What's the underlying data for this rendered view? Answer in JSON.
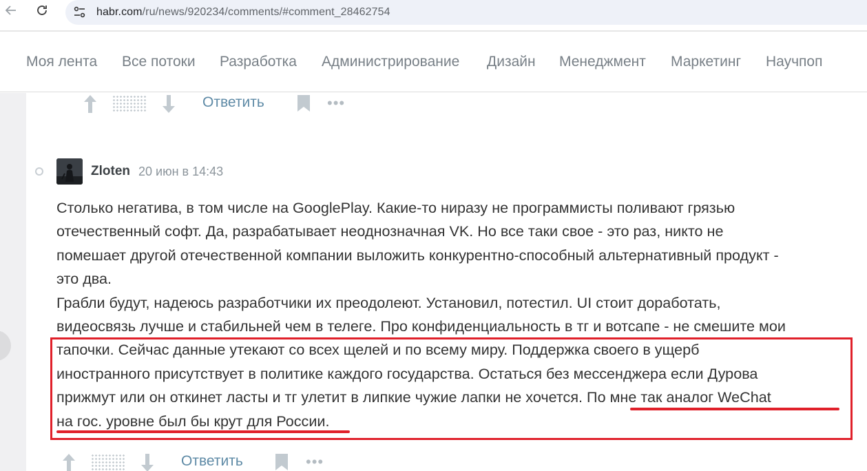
{
  "browser": {
    "url_host": "habr.com",
    "url_path": "/ru/news/920234/comments/#comment_28462754"
  },
  "menu": {
    "items": [
      "Моя лента",
      "Все потоки",
      "Разработка",
      "Администрирование",
      "Дизайн",
      "Менеджмент",
      "Маркетинг",
      "Научпоп"
    ]
  },
  "actions": {
    "reply_label": "Ответить",
    "more_label": "•••"
  },
  "comment": {
    "author": "Zloten",
    "timestamp": "20 июн в 14:43",
    "lines": [
      "Столько негатива, в том числе на GooglePlay. Какие-то ниразу не программисты поливают грязью",
      "отечественный софт. Да, разрабатывает неоднозначная VK. Но все таки свое - это раз, никто не",
      "помешает другой отечественной компании выложить конкурентно-способный альтернативный продукт -",
      "это два.",
      "Грабли будут, надеюсь разработчики их преодолеют. Установил, потестил. UI стоит доработать,",
      "видеосвязь лучше и стабильней чем в телеге. Про конфиденциальность в тг и вотсапе - не смешите мои",
      "тапочки. Сейчас данные утекают со всех щелей и по всему миру. Поддержка своего в ущерб",
      "иностранного присутствует в политике каждого государства. Остаться без мессенджера если Дурова",
      "прижмут или он откинет ласты и тг улетит в липкие чужие лапки не хочется. По мне так аналог WeChat",
      "на гос. уровне был бы крут для России."
    ]
  },
  "colors": {
    "accent_link": "#5e8aa6",
    "highlight_red": "#e0202a"
  },
  "icons": [
    "back-arrow-icon",
    "reload-icon",
    "site-settings-icon",
    "upvote-arrow-icon",
    "downvote-arrow-icon",
    "bookmark-icon",
    "more-icon",
    "avatar"
  ]
}
